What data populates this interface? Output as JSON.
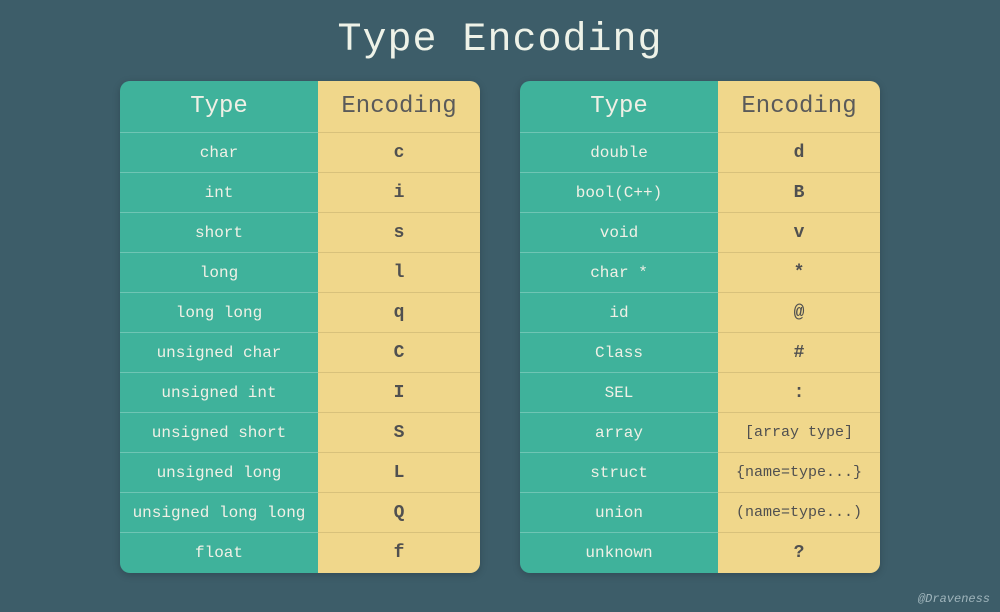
{
  "title": "Type Encoding",
  "credit": "@Draveness",
  "headers": {
    "type": "Type",
    "encoding": "Encoding"
  },
  "table1": [
    {
      "type": "char",
      "encoding": "c"
    },
    {
      "type": "int",
      "encoding": "i"
    },
    {
      "type": "short",
      "encoding": "s"
    },
    {
      "type": "long",
      "encoding": "l"
    },
    {
      "type": "long long",
      "encoding": "q"
    },
    {
      "type": "unsigned char",
      "encoding": "C"
    },
    {
      "type": "unsigned int",
      "encoding": "I"
    },
    {
      "type": "unsigned short",
      "encoding": "S"
    },
    {
      "type": "unsigned long",
      "encoding": "L"
    },
    {
      "type": "unsigned long long",
      "encoding": "Q"
    },
    {
      "type": "float",
      "encoding": "f"
    }
  ],
  "table2": [
    {
      "type": "double",
      "encoding": "d"
    },
    {
      "type": "bool(C++)",
      "encoding": "B"
    },
    {
      "type": "void",
      "encoding": "v"
    },
    {
      "type": "char *",
      "encoding": "*"
    },
    {
      "type": "id",
      "encoding": "@"
    },
    {
      "type": "Class",
      "encoding": "#"
    },
    {
      "type": "SEL",
      "encoding": ":"
    },
    {
      "type": "array",
      "encoding": "[array type]",
      "small": true
    },
    {
      "type": "struct",
      "encoding": "{name=type...}",
      "small": true
    },
    {
      "type": "union",
      "encoding": "(name=type...)",
      "small": true
    },
    {
      "type": "unknown",
      "encoding": "?"
    }
  ]
}
